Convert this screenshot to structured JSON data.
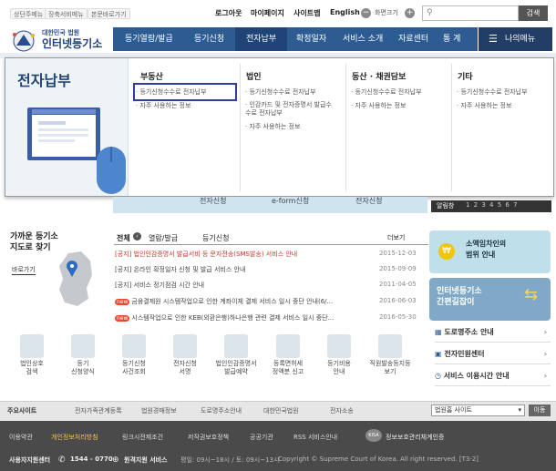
{
  "utility": {
    "links": [
      "상단주메뉴",
      "장축서비메뉴",
      "본문바로가기"
    ],
    "logout": "로그아웃",
    "mypage": "마이페이지",
    "sitemap": "사이트맵",
    "english": "English",
    "zoom_label": "화면크기",
    "search_button": "검색"
  },
  "logo": {
    "org": "대한민국 법원",
    "name": "인터넷등기소"
  },
  "nav": {
    "items": [
      "등기열람/발급",
      "등기신청",
      "전자납부",
      "확정일자",
      "서비스 소개",
      "자료센터",
      "통 계"
    ],
    "my_menu": "나의메뉴"
  },
  "mega": {
    "title": "전자납부",
    "columns": [
      {
        "head": "부동산",
        "items": [
          "등기신청수수료 전자납부",
          "자주 사용하는 정보"
        ]
      },
      {
        "head": "법인",
        "items": [
          "등기신청수수료 전자납부",
          "인감카드 및 전자증명서 발급수수료 전자납부",
          "자주 사용하는 정보"
        ]
      },
      {
        "head": "동산 · 채권담보",
        "items": [
          "등기신청수수료 전자납부",
          "자주 사용하는 정보"
        ]
      },
      {
        "head": "기타",
        "items": [
          "등기신청수수료 전자납부",
          "자주 사용하는 정보"
        ]
      }
    ]
  },
  "banner_strip": {
    "items": [
      "전자신청",
      "e-form신청",
      "전자신청"
    ],
    "slider_label": "알림창",
    "slider_pages": "1 2 3 4 5 6 7"
  },
  "branch": {
    "title": "가까운 등기소\n지도로 찾기",
    "shortcut": "바로가기"
  },
  "notice": {
    "tabs": [
      "전체",
      "열람/발급",
      "등기신청"
    ],
    "more": "더보기",
    "rows": [
      {
        "text": "[공지] 법인인감증명서 발급서비 등 문자전송(SMS발송) 서비스 안내",
        "date": "2015-12-03",
        "new": false
      },
      {
        "text": "[공지] 온라인 확정일자 신청 및 발급 서비스 안내",
        "date": "2015-09-09",
        "new": false
      },
      {
        "text": "[공지] 서비스 정기점검 시간 안내",
        "date": "2011-04-05",
        "new": false
      },
      {
        "text": "금융결제원 시스템작업으로 인한 계좌이체 결제 서비스 일시 중단 안내(6/...",
        "date": "2016-06-03",
        "new": true
      },
      {
        "text": "시스템작업으로 인한 KEB(외환은행)하나은행 관련 결제 서비스 일시 중단...",
        "date": "2016-05-30",
        "new": true
      }
    ]
  },
  "right": {
    "banner1": "소액임차인의\n범위 안내",
    "banner2": "인터넷등기소\n간편길잡이",
    "links": [
      "도로명주소 안내",
      "전자민원센터",
      "서비스 이용시간 안내"
    ]
  },
  "quick": [
    "법인상호\n검색",
    "등기\n신청양식",
    "등기신청\n사건조회",
    "전자신청\n서명",
    "법인인감증명서\n발급예약",
    "등록면허세\n정액분 신고",
    "등기비용\n안내",
    "직원발송등지등\n보기"
  ],
  "related": {
    "label": "주요사이트",
    "links": [
      "전자가족관계등록",
      "법원경매정보",
      "도로명주소안내",
      "대한민국법원",
      "전자소송"
    ],
    "select": "법원홈 사이트",
    "go": "이동"
  },
  "footer": {
    "links": [
      "이용약관",
      "개인정보처리방침",
      "링크시전제조건",
      "저작권보호정책",
      "공공기관",
      "RSS 서비스안내"
    ],
    "privacy_mark": "정보보호관리체계인증",
    "center": "사용자지원센터",
    "phone": "1544 - 0770",
    "remote": "원격지원 서비스",
    "hours": "평일: 09시~18시 / 토: 09시~13시",
    "copyright": "Copyright © Supreme Court of Korea. All right reserved. [T3-2]"
  },
  "colors": {
    "nav": "#2d5c92",
    "highlight": "#2d3ea3",
    "footer": "#4a4a4a"
  }
}
